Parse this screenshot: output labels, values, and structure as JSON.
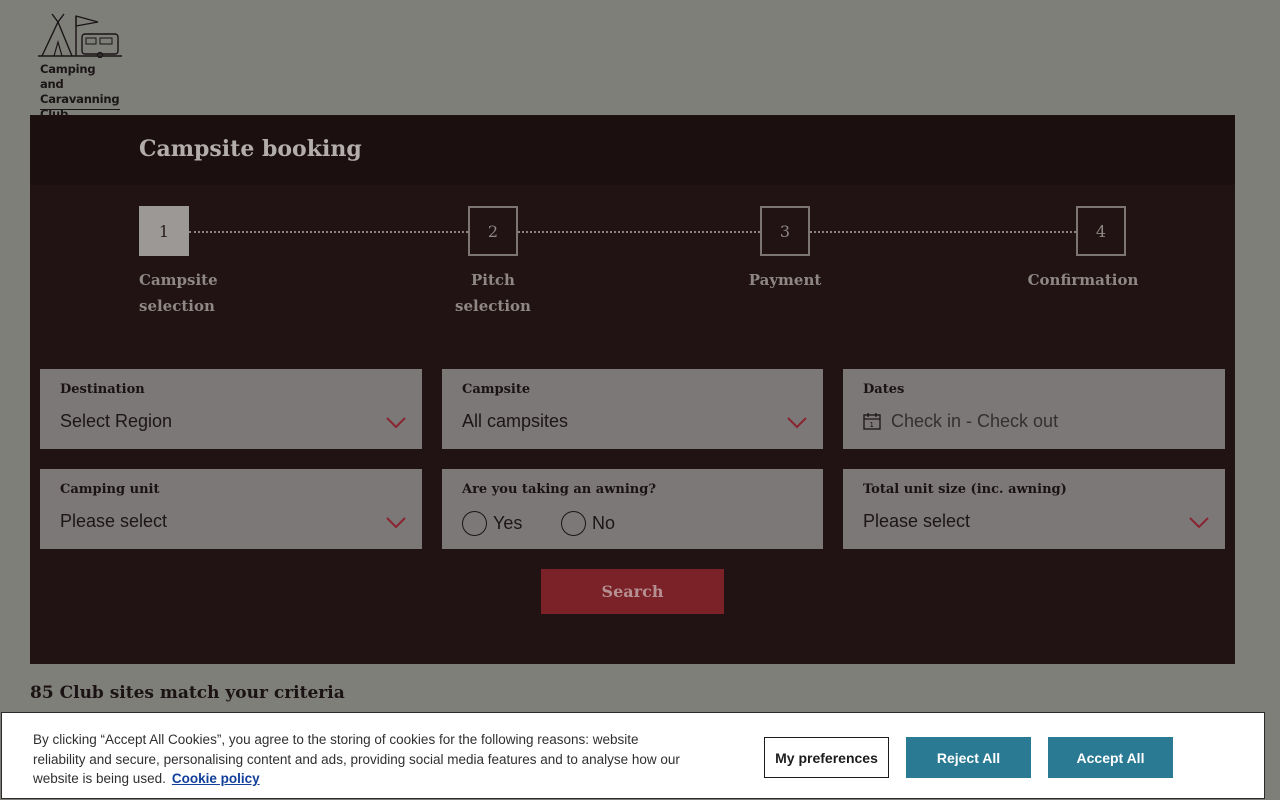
{
  "brand": {
    "name": "Camping and\nCaravanning\nClub"
  },
  "booking": {
    "title": "Campsite booking",
    "steps": [
      {
        "number": "1",
        "label": "Campsite\nselection"
      },
      {
        "number": "2",
        "label": "Pitch\nselection"
      },
      {
        "number": "3",
        "label": "Payment"
      },
      {
        "number": "4",
        "label": "Confirmation"
      }
    ],
    "active_step": 1,
    "destination": {
      "label": "Destination",
      "value": "Select Region"
    },
    "campsite": {
      "label": "Campsite",
      "value": "All campsites"
    },
    "dates": {
      "label": "Dates",
      "placeholder": "Check in - Check out"
    },
    "camping_unit": {
      "label": "Camping unit",
      "value": "Please select"
    },
    "awning": {
      "label": "Are you taking an awning?",
      "yes": "Yes",
      "no": "No"
    },
    "unit_size": {
      "label": "Total unit size (inc. awning)",
      "value": "Please select"
    },
    "search_label": "Search"
  },
  "results": {
    "text": "85 Club sites match your criteria"
  },
  "cookie": {
    "text": "By clicking “Accept All Cookies”, you agree to the storing of cookies for the following reasons: website reliability and secure, personalising content and ads, providing social media features and to analyse how our website is being used.",
    "link": "Cookie policy",
    "preferences": "My preferences",
    "reject": "Reject All",
    "accept": "Accept All"
  },
  "colors": {
    "panel": "#211314",
    "field": "#7b7877",
    "accent": "#7a2228",
    "cookie_button": "#2a7a94"
  },
  "icons": [
    "chevron-down-icon",
    "calendar-icon"
  ]
}
